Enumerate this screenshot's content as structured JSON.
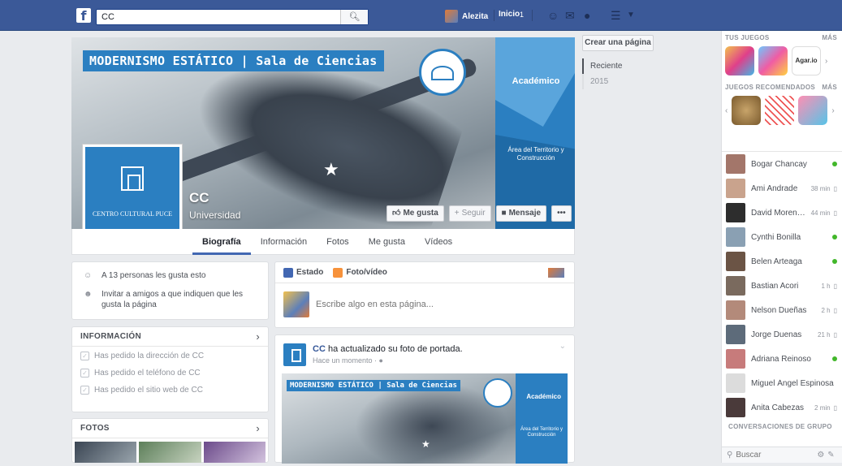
{
  "topbar": {
    "logo": "f",
    "search_value": "CC",
    "search_placeholder": "Buscar",
    "user_name": "Alezita",
    "home_label": "Inicio",
    "home_count": "1"
  },
  "page": {
    "cover_title": "MODERNISMO ESTÁTICO | Sala de Ciencias",
    "cover_panel_top": "Académico",
    "cover_panel_bottom": "Área del Territorio y Construcción",
    "profile_label": "CENTRO CULTURAL PUCE",
    "name": "CC",
    "category": "Universidad",
    "actions": {
      "like": "Me gusta",
      "follow": "Seguir",
      "message": "Mensaje",
      "more": "•••"
    },
    "tabs": [
      "Biografía",
      "Información",
      "Fotos",
      "Me gusta",
      "Vídeos"
    ]
  },
  "left": {
    "likes_text": "A 13 personas les gusta esto",
    "invite_text": "Invitar a amigos a que indiquen que les gusta la página",
    "info_header": "INFORMACIÓN",
    "info_items": [
      "Has pedido la dirección de CC",
      "Has pedido el teléfono de CC",
      "Has pedido el sitio web de CC"
    ],
    "photos_header": "FOTOS"
  },
  "composer": {
    "tab_status": "Estado",
    "tab_photo": "Foto/vídeo",
    "placeholder": "Escribe algo en esta página..."
  },
  "post": {
    "author": "CC",
    "action": " ha actualizado su foto de portada.",
    "time": "Hace un momento",
    "image_title": "MODERNISMO ESTÁTICO | Sala de Ciencias",
    "image_panel_top": "Académico",
    "image_panel_bottom": "Área del Territorio y Construcción"
  },
  "sidebar": {
    "create_page": "Crear una página",
    "timeline": [
      "Reciente",
      "2015"
    ]
  },
  "right": {
    "games_header": "TUS JUEGOS",
    "more_label": "MÁS",
    "recommended_header": "JUEGOS RECOMENDADOS",
    "game_label": "Agar.io",
    "chats": [
      {
        "name": "Bogar Chancay",
        "time": "",
        "online": true
      },
      {
        "name": "Ami Andrade",
        "time": "38 min",
        "online": false
      },
      {
        "name": "David Moreno...",
        "time": "44 min",
        "online": false
      },
      {
        "name": "Cynthi Bonilla",
        "time": "",
        "online": true
      },
      {
        "name": "Belen Arteaga",
        "time": "",
        "online": true
      },
      {
        "name": "Bastian Acori",
        "time": "1 h",
        "online": false
      },
      {
        "name": "Nelson Dueñas",
        "time": "2 h",
        "online": false
      },
      {
        "name": "Jorge Duenas",
        "time": "21 h",
        "online": false
      },
      {
        "name": "Adriana Reinoso",
        "time": "",
        "online": true
      },
      {
        "name": "Miguel Ángel Espinosa",
        "time": "",
        "online": false
      },
      {
        "name": "Anita Cabezas",
        "time": "2 min",
        "online": false
      }
    ],
    "group_header": "CONVERSACIONES DE GRUPO",
    "search_placeholder": "Buscar"
  }
}
